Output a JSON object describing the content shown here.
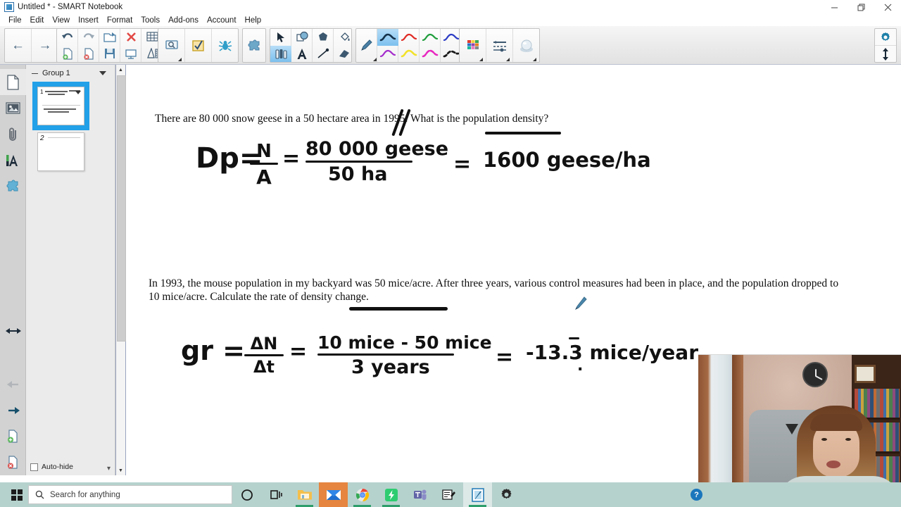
{
  "window": {
    "title": "Untitled * - SMART Notebook",
    "app_icon": "smart-notebook-icon",
    "minimize": "—",
    "restore": "❐",
    "close": "✕"
  },
  "menu": {
    "items": [
      "File",
      "Edit",
      "View",
      "Insert",
      "Format",
      "Tools",
      "Add-ons",
      "Account",
      "Help"
    ]
  },
  "toolbar": {
    "nav": [
      {
        "name": "previous-page-button",
        "icon": "arrow-left-icon",
        "glyph": "←"
      },
      {
        "name": "next-page-button",
        "icon": "arrow-right-icon",
        "glyph": "→"
      }
    ],
    "edit_group": [
      {
        "name": "undo-button",
        "icon": "undo-icon"
      },
      {
        "name": "add-page-button",
        "icon": "page-add-icon"
      },
      {
        "name": "redo-button",
        "icon": "redo-icon"
      },
      {
        "name": "delete-page-button",
        "icon": "page-delete-icon"
      },
      {
        "name": "open-file-button",
        "icon": "folder-open-icon"
      },
      {
        "name": "save-button",
        "icon": "save-icon"
      },
      {
        "name": "delete-button",
        "icon": "delete-x-icon"
      },
      {
        "name": "screen-shade-button",
        "icon": "screen-shade-icon"
      },
      {
        "name": "table-button",
        "icon": "table-icon"
      },
      {
        "name": "measurement-tools-button",
        "icon": "ruler-icon"
      }
    ],
    "capture_group": [
      {
        "name": "screen-capture-button",
        "icon": "screen-capture-icon"
      },
      {
        "name": "response-button",
        "icon": "checkbox-check-icon"
      },
      {
        "name": "smart-lab-button",
        "icon": "insect-icon"
      }
    ],
    "addons_group": [
      {
        "name": "add-ons-button",
        "icon": "puzzle-piece-icon"
      }
    ],
    "select_group": [
      {
        "name": "select-tool",
        "icon": "cursor-arrow-icon"
      },
      {
        "name": "shapes-tool",
        "icon": "shapes-icon"
      },
      {
        "name": "shape-pen-tool",
        "icon": "polygon-icon"
      },
      {
        "name": "fill-tool",
        "icon": "paint-bucket-icon"
      },
      {
        "name": "pens-tool",
        "icon": "pens-icon",
        "selected": true
      },
      {
        "name": "text-tool",
        "icon": "text-a-icon"
      },
      {
        "name": "line-tool",
        "icon": "line-icon"
      },
      {
        "name": "eraser-tool",
        "icon": "eraser-icon"
      }
    ],
    "pen_group": [
      {
        "name": "pen-style-pencil",
        "icon": "pencil-icon",
        "color": "#4b7fa6"
      },
      {
        "name": "pen-stroke-black-blue",
        "icon": "stroke-icon",
        "color": "#1a1a1a",
        "selected": true
      },
      {
        "name": "pen-stroke-red",
        "icon": "stroke-icon",
        "color": "#e02a24"
      },
      {
        "name": "pen-stroke-green",
        "icon": "stroke-icon",
        "color": "#1f9e3c"
      },
      {
        "name": "pen-stroke-blue",
        "icon": "stroke-icon",
        "color": "#2c3cc4"
      },
      {
        "name": "pen-stroke-purple",
        "icon": "stroke-icon",
        "color": "#a42ccb"
      },
      {
        "name": "pen-stroke-yellow",
        "icon": "stroke-icon",
        "color": "#f2e22a"
      },
      {
        "name": "pen-stroke-magenta",
        "icon": "stroke-icon",
        "color": "#e828c0"
      },
      {
        "name": "pen-stroke-dashed-black",
        "icon": "stroke-dashed-icon",
        "color": "#1a1a1a"
      }
    ],
    "props_group": [
      {
        "name": "color-palette-button",
        "icon": "color-grid-icon"
      },
      {
        "name": "line-properties-button",
        "icon": "line-properties-icon"
      },
      {
        "name": "transparency-button",
        "icon": "transparency-sphere-icon"
      }
    ],
    "right_group": [
      {
        "name": "settings-button",
        "icon": "gear-icon"
      },
      {
        "name": "move-toolbar-button",
        "icon": "arrows-vertical-icon"
      }
    ]
  },
  "rail": {
    "items": [
      {
        "name": "page-sorter-tab",
        "icon": "page-icon",
        "selected": true
      },
      {
        "name": "gallery-tab",
        "icon": "image-icon"
      },
      {
        "name": "attachments-tab",
        "icon": "paperclip-icon"
      },
      {
        "name": "properties-tab",
        "icon": "text-properties-icon"
      },
      {
        "name": "addons-tab",
        "icon": "puzzle-piece-icon"
      }
    ],
    "bottom": [
      {
        "name": "sidebar-resize-handle",
        "icon": "arrows-horizontal-icon"
      },
      {
        "name": "rail-back-button",
        "icon": "arrow-left-icon"
      },
      {
        "name": "rail-forward-button",
        "icon": "arrow-right-icon"
      },
      {
        "name": "rail-add-page-button",
        "icon": "page-add-icon"
      },
      {
        "name": "rail-delete-page-button",
        "icon": "page-delete-icon"
      }
    ]
  },
  "sidebar": {
    "group_label": "Group 1",
    "pages": [
      {
        "number": "1",
        "selected": true
      },
      {
        "number": "2",
        "selected": false
      }
    ],
    "autohide_label": "Auto-hide",
    "autohide_checked": false
  },
  "canvas": {
    "question1": "There are 80 000 snow geese in a 50 hectare area in 1995. What is the population density?",
    "question2": "In 1993, the mouse population in my backyard was 50 mice/acre. After three years, various control measures had been in place, and the population dropped to 10 mice/acre. Calculate the rate of density change.",
    "work1": {
      "label": "Dp=",
      "formula_num": "N",
      "formula_den": "A",
      "eq1": "=",
      "value_num": "80 000 geese",
      "value_den": "50 ha",
      "eq2": "=",
      "result": "1600 geese/ha"
    },
    "work2": {
      "label": "gr =",
      "formula_num": "ΔN",
      "formula_den": "Δt",
      "eq1": "=",
      "value_num": "10 mice - 50 mice",
      "value_den": "3 years",
      "eq2": "=",
      "result_pre": "-13.",
      "result_repeat": "3",
      "result_post": " mice/year"
    },
    "pen_cursor_icon": "pen-cursor-icon"
  },
  "taskbar": {
    "start_icon": "windows-start-icon",
    "search_placeholder": "Search for anything",
    "search_icon": "search-icon",
    "items": [
      {
        "name": "cortana-button",
        "icon": "cortana-circle-icon"
      },
      {
        "name": "task-view-button",
        "icon": "task-view-icon"
      },
      {
        "name": "file-explorer-button",
        "icon": "folder-icon",
        "running": true
      },
      {
        "name": "mail-button",
        "icon": "mail-envelope-icon",
        "active": true
      },
      {
        "name": "chrome-button",
        "icon": "chrome-icon",
        "running": true
      },
      {
        "name": "shazam-button",
        "icon": "green-bolt-icon"
      },
      {
        "name": "teams-button",
        "icon": "teams-icon"
      },
      {
        "name": "notes-button",
        "icon": "notepad-pen-icon"
      },
      {
        "name": "smart-notebook-button",
        "icon": "smart-notebook-icon",
        "running": true,
        "focused": true
      },
      {
        "name": "settings-button",
        "icon": "gear-icon"
      }
    ],
    "help_badge": "?"
  },
  "webcam": {
    "label": "webcam-overlay"
  }
}
